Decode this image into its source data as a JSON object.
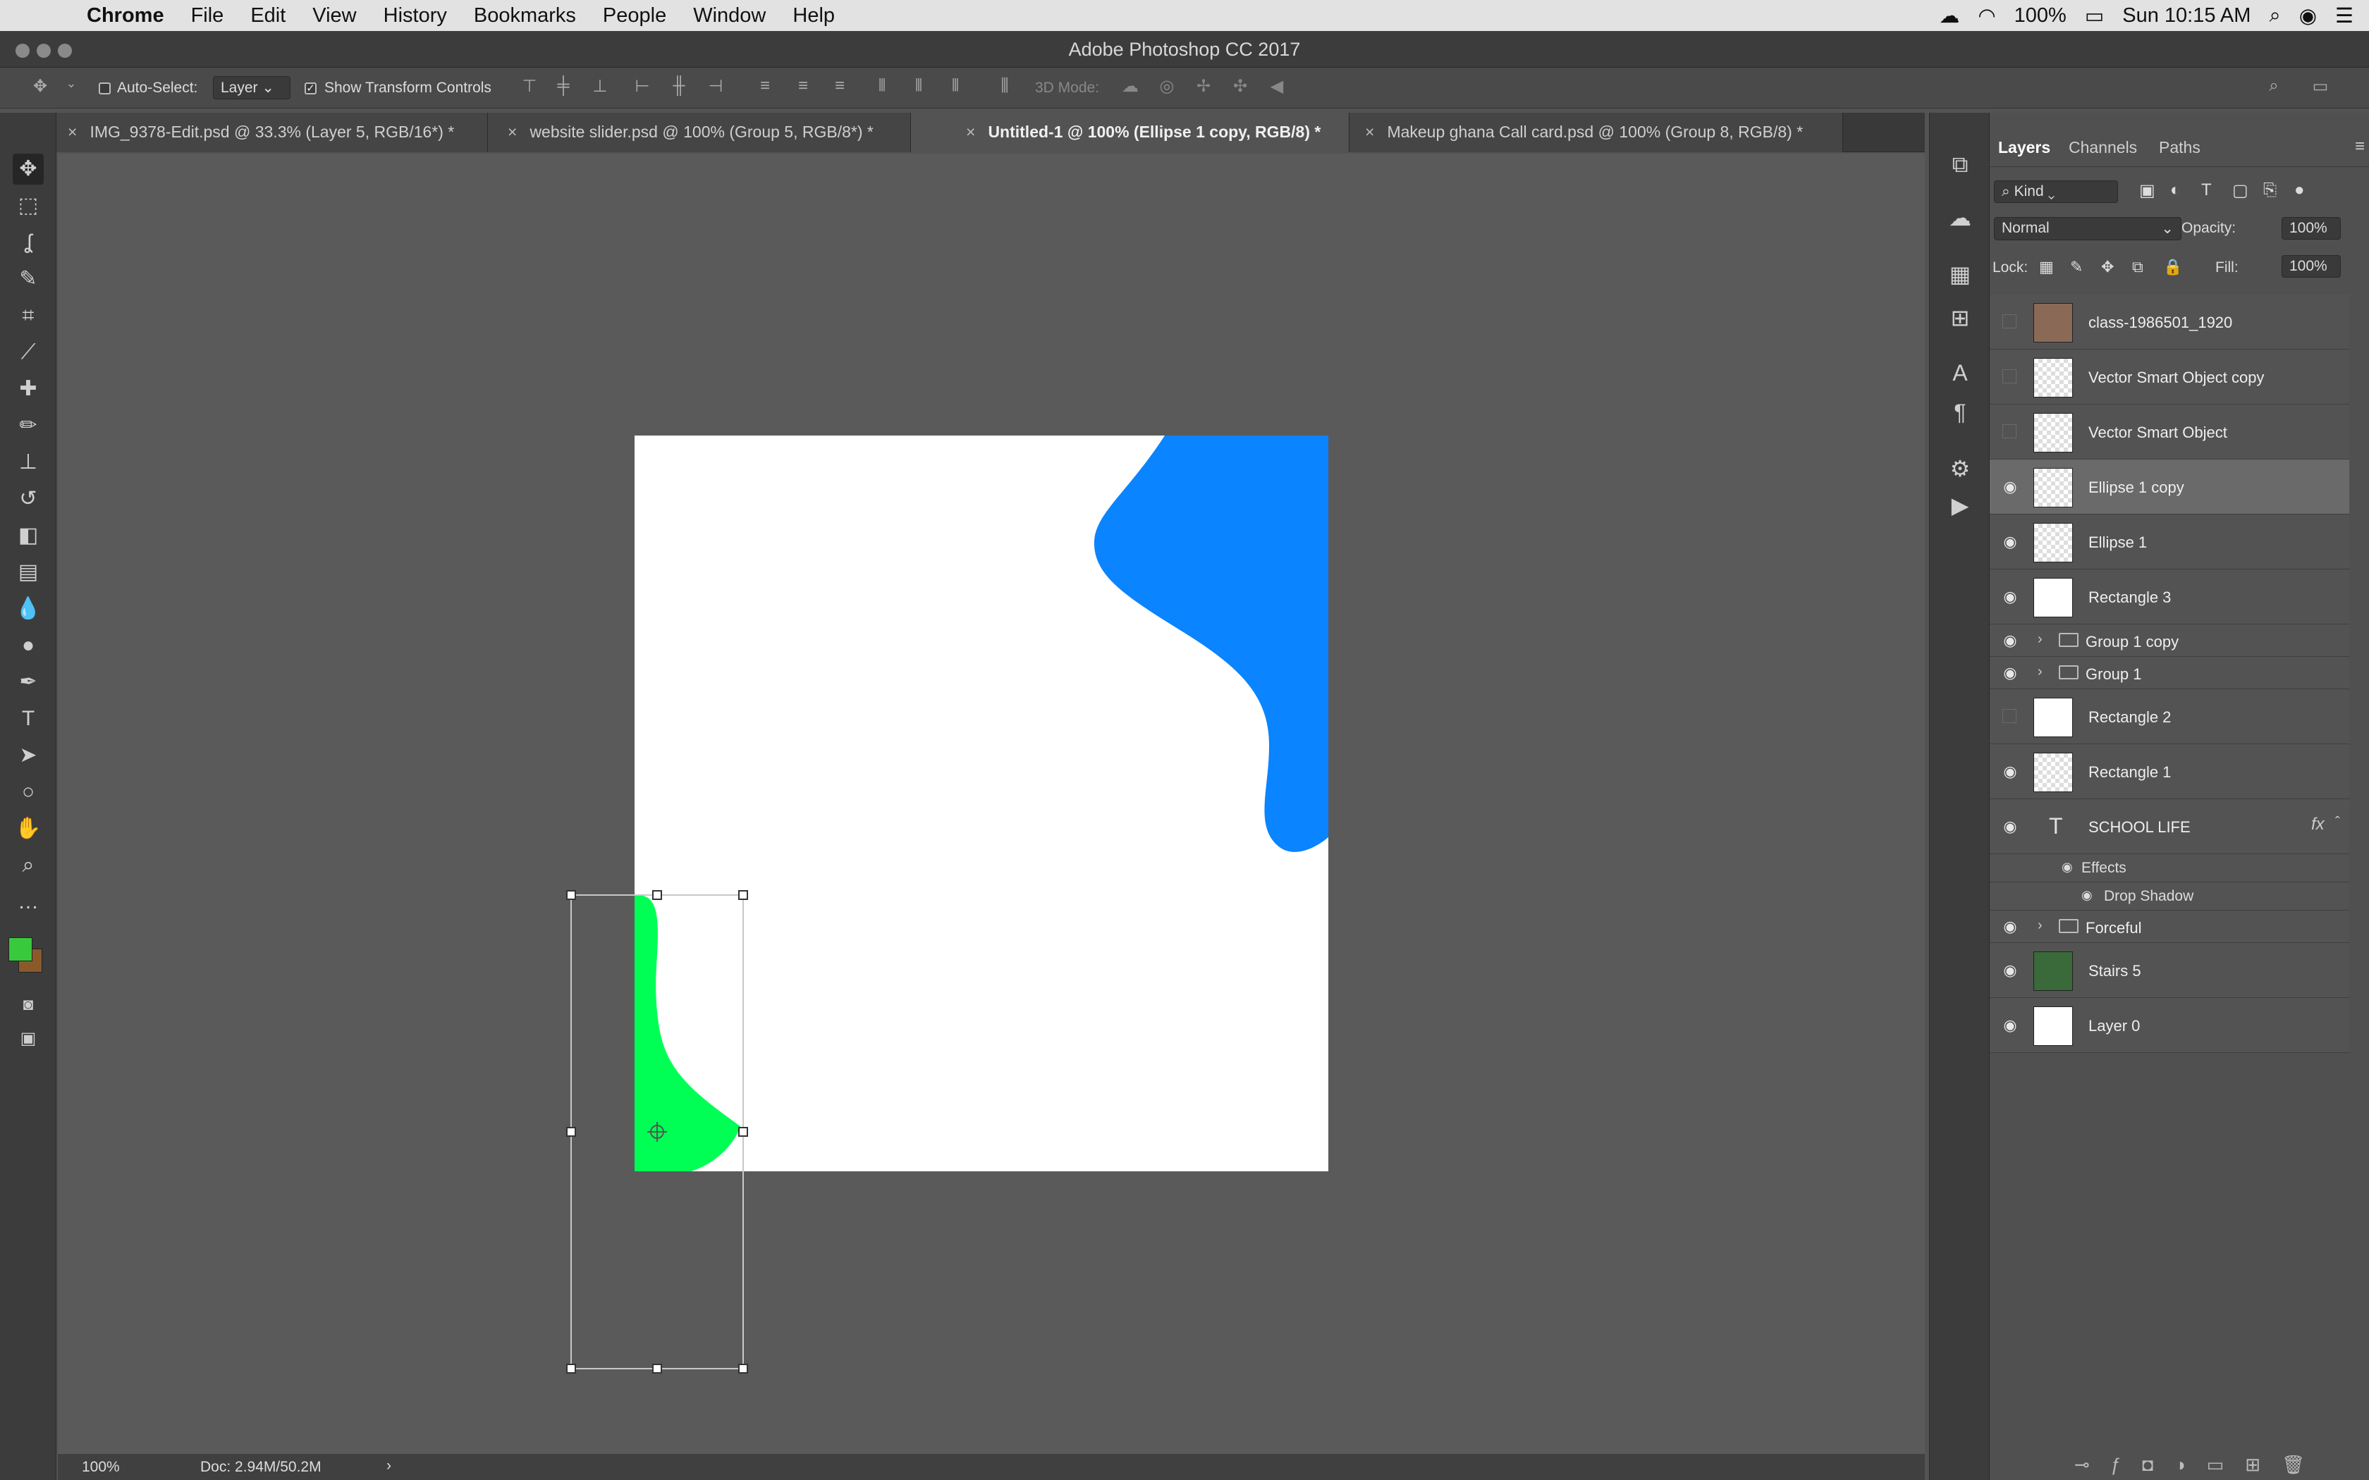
{
  "menubar": {
    "app": "Chrome",
    "items": [
      "File",
      "Edit",
      "View",
      "History",
      "Bookmarks",
      "People",
      "Window",
      "Help"
    ],
    "battery": "100%",
    "clock": "Sun 10:15 AM"
  },
  "window": {
    "title": "Adobe Photoshop CC 2017"
  },
  "options": {
    "auto_select_label": "Auto-Select:",
    "auto_select_value": "Layer",
    "show_transform_label": "Show Transform Controls",
    "mode3d_label": "3D Mode:"
  },
  "tabs": [
    {
      "label": "IMG_9378-Edit.psd @ 33.3% (Layer 5, RGB/16*) *"
    },
    {
      "label": "website slider.psd @ 100% (Group 5, RGB/8*) *"
    },
    {
      "label": "Untitled-1 @ 100% (Ellipse 1 copy, RGB/8) *"
    },
    {
      "label": "Makeup ghana Call card.psd @ 100% (Group 8, RGB/8) *"
    }
  ],
  "status": {
    "zoom": "100%",
    "doc": "Doc: 2.94M/50.2M"
  },
  "colors": {
    "foreground": "#39c93c",
    "background": "#8b5a2b",
    "blue_shape": "#0a84ff",
    "green_shape": "#00ff55"
  },
  "layers_panel": {
    "tabs": [
      "Layers",
      "Channels",
      "Paths"
    ],
    "filter": "Kind",
    "blend_mode": "Normal",
    "opacity_label": "Opacity:",
    "opacity": "100%",
    "lock_label": "Lock:",
    "fill_label": "Fill:",
    "fill": "100%",
    "layers": [
      {
        "name": "class-1986501_1920"
      },
      {
        "name": "Vector Smart Object copy"
      },
      {
        "name": "Vector Smart Object"
      },
      {
        "name": "Ellipse 1 copy"
      },
      {
        "name": "Ellipse 1"
      },
      {
        "name": "Rectangle 3"
      },
      {
        "name": "Group 1 copy"
      },
      {
        "name": "Group 1"
      },
      {
        "name": "Rectangle 2"
      },
      {
        "name": "Rectangle 1"
      },
      {
        "name": "SCHOOL LIFE"
      },
      {
        "name": "Forceful"
      },
      {
        "name": "Stairs 5"
      },
      {
        "name": "Layer 0"
      }
    ],
    "effects_label": "Effects",
    "drop_shadow_label": "Drop Shadow",
    "fx_label": "fx"
  }
}
